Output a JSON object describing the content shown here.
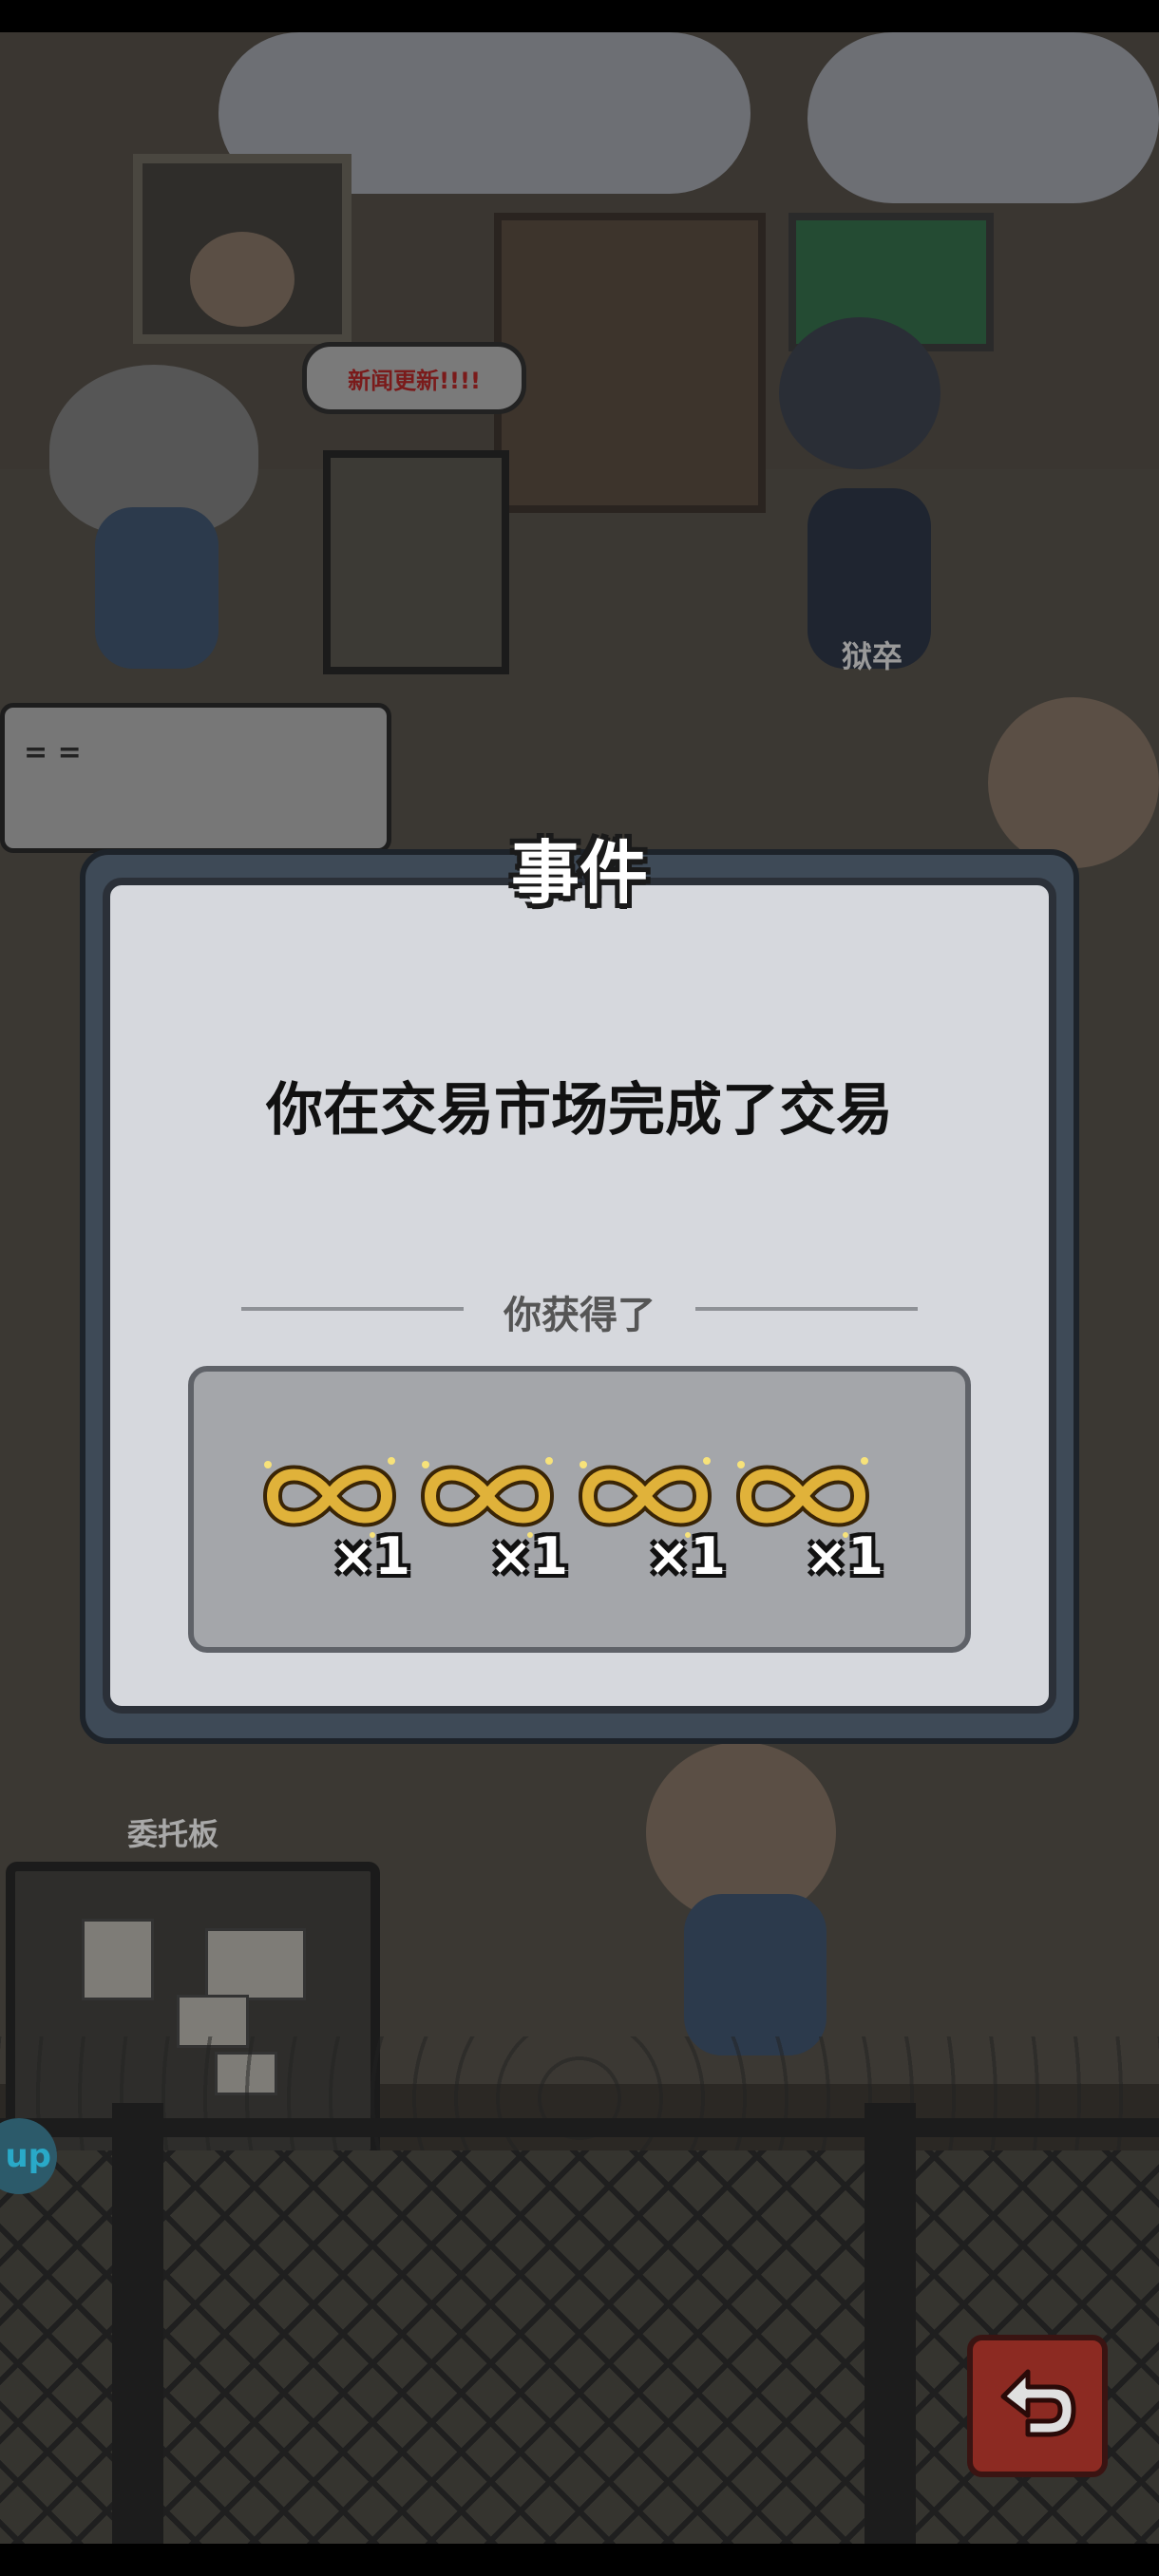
{
  "scene": {
    "news_bubble": "新闻更新!!!!",
    "guard_label": "狱卒",
    "speech_text": "= =",
    "notice_board_title": "委托板",
    "up_button": "up"
  },
  "modal": {
    "title": "事件",
    "message": "你在交易市场完成了交易",
    "reward_label": "你获得了",
    "rewards": [
      {
        "icon": "infinity-ring-icon",
        "count": "×1"
      },
      {
        "icon": "infinity-ring-icon",
        "count": "×1"
      },
      {
        "icon": "infinity-ring-icon",
        "count": "×1"
      },
      {
        "icon": "infinity-ring-icon",
        "count": "×1"
      }
    ]
  },
  "colors": {
    "gold": "#e0b23a",
    "back_button": "#c0392b"
  }
}
